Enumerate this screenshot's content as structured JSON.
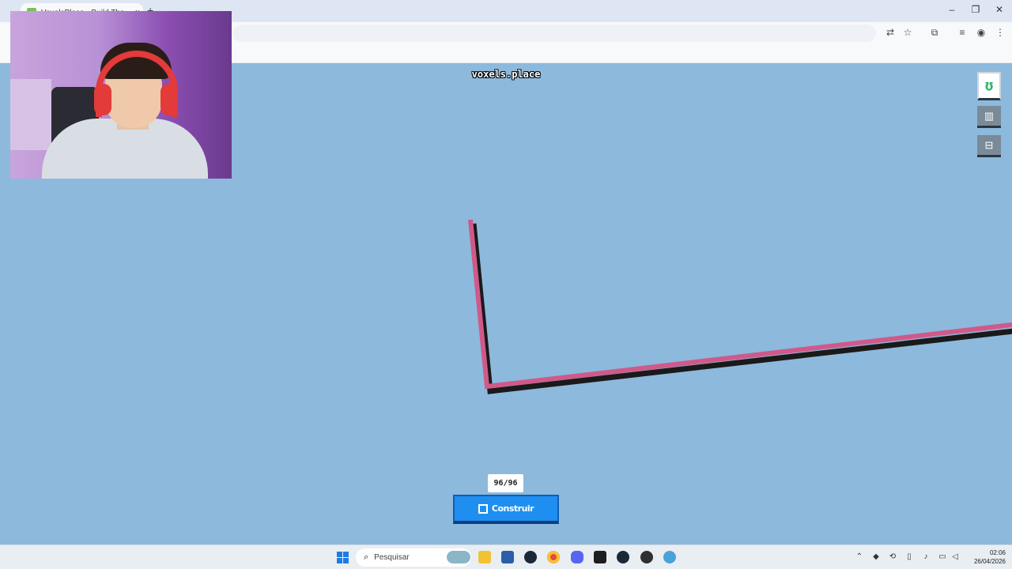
{
  "browser": {
    "tab_title": "VoxelsPlace - Build The Earth",
    "tab_close": "×",
    "new_tab": "+",
    "window_controls": {
      "minimize": "–",
      "restore": "❐",
      "close": "✕"
    },
    "toolbar_icons": [
      "translate-icon",
      "star-icon",
      "extensions-icon",
      "media-icon",
      "profile-icon",
      "menu-icon"
    ]
  },
  "game": {
    "title": "voxels.place",
    "counter": "96/96",
    "build_label": "Construir",
    "side_buttons": [
      "logo",
      "stats-icon",
      "shop-icon"
    ],
    "path_color": "#cf5a8a"
  },
  "taskbar": {
    "search_placeholder": "Pesquisar",
    "clock_time": "02:06",
    "clock_date": "26/04/2026",
    "apps": [
      "widget-icon",
      "file-explorer-icon",
      "store-icon",
      "steam-icon",
      "chrome-icon",
      "discord-icon",
      "terminal-icon",
      "steam-alt-icon",
      "obs-icon",
      "edge-icon"
    ]
  }
}
